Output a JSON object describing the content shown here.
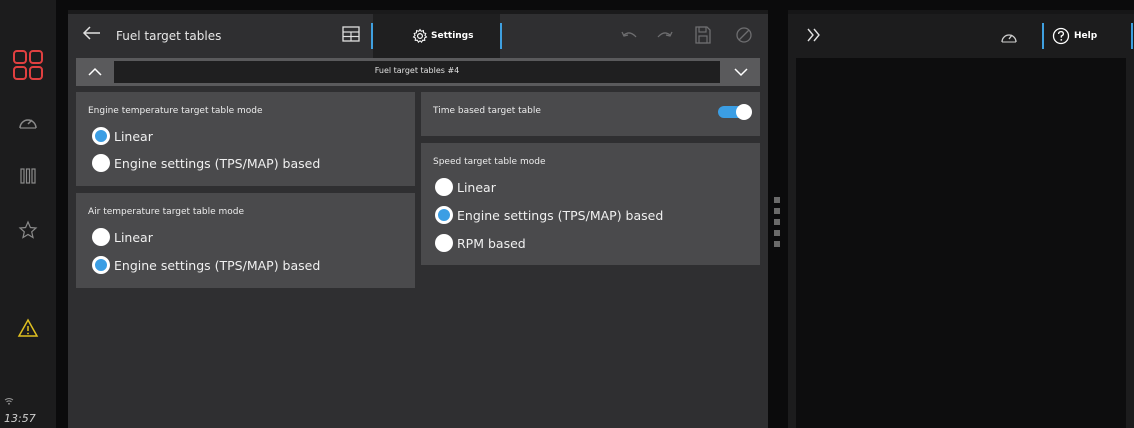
{
  "app": {
    "clock": "13:57",
    "accent": "#3b9ee4",
    "alert_color": "#e0c020",
    "brand_color": "#e04040"
  },
  "rail": {
    "items": [
      {
        "icon": "dashboard-grid-icon"
      },
      {
        "icon": "gauge-icon"
      },
      {
        "icon": "bars-icon"
      },
      {
        "icon": "star-icon"
      },
      {
        "icon": "warning-icon"
      }
    ]
  },
  "header": {
    "title": "Fuel target tables",
    "settings_label": "Settings"
  },
  "selector": {
    "label": "Fuel target tables #4"
  },
  "cards": {
    "engine_temp": {
      "title": "Engine temperature target table mode",
      "options": [
        "Linear",
        "Engine settings (TPS/MAP) based"
      ],
      "selected": 0
    },
    "air_temp": {
      "title": "Air temperature target table mode",
      "options": [
        "Linear",
        "Engine settings (TPS/MAP) based"
      ],
      "selected": 1
    },
    "time_based": {
      "title": "Time based target table",
      "enabled": true
    },
    "speed": {
      "title": "Speed target table mode",
      "options": [
        "Linear",
        "Engine settings (TPS/MAP) based",
        "RPM based"
      ],
      "selected": 1
    }
  },
  "right_panel": {
    "help_label": "Help"
  }
}
